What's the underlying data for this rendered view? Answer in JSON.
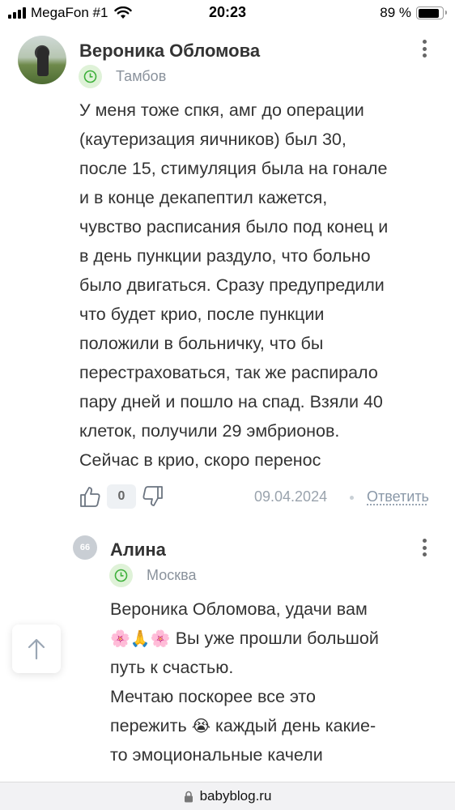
{
  "status_bar": {
    "carrier": "MegaFon #1",
    "time": "20:23",
    "battery": "89 %",
    "battery_level": 0.89
  },
  "comment1": {
    "author": "Вероника Обломова",
    "city": "Тамбов",
    "text_lines": [
      "У меня тоже спкя, амг до операции",
      "(каутеризация яичников) был 30,",
      "после 15, стимуляция была на гонале",
      "и в конце декапептил кажется,",
      "чувство расписания было под конец и",
      "в день пункции раздуло, что больно",
      "было двигаться. Сразу предупредили",
      "что будет крио, после пункции",
      "положили в больничку, что бы",
      "перестраховаться, так же распирало",
      "пару дней и пошло на спад. Взяли 40",
      "клеток, получили 29 эмбрионов.",
      "Сейчас в крио, скоро перенос"
    ],
    "votes": "0",
    "date": "09.04.2024",
    "reply": "Ответить"
  },
  "comment2": {
    "author": "Алина",
    "avatar_text": "66",
    "city": "Москва",
    "mention": "Вероника Обломова",
    "line1_rest": ", удачи вам",
    "line2_rest": " Вы уже прошли большой",
    "line3": "путь к счастью.",
    "line4": "Мечтаю поскорее все это",
    "line5_start": "пережить ",
    "line5_rest": " каждый день какие-",
    "line6": "то эмоциональные качели"
  },
  "url_bar": {
    "url": "babyblog.ru"
  },
  "icons": {
    "avatar1": "user-photo",
    "city_badge": "clock-icon",
    "menu": "more-vertical-icon",
    "like": "thumbs-up-icon",
    "dislike": "thumbs-down-icon",
    "scroll": "arrow-up-icon",
    "lock": "lock-icon",
    "emojis": [
      "cherry-blossom",
      "folded-hands",
      "cherry-blossom",
      "loudly-crying-face"
    ]
  },
  "colors": {
    "badge_green": "#dff2d8",
    "clock_green": "#3db03a",
    "muted_text": "#8a929c"
  }
}
